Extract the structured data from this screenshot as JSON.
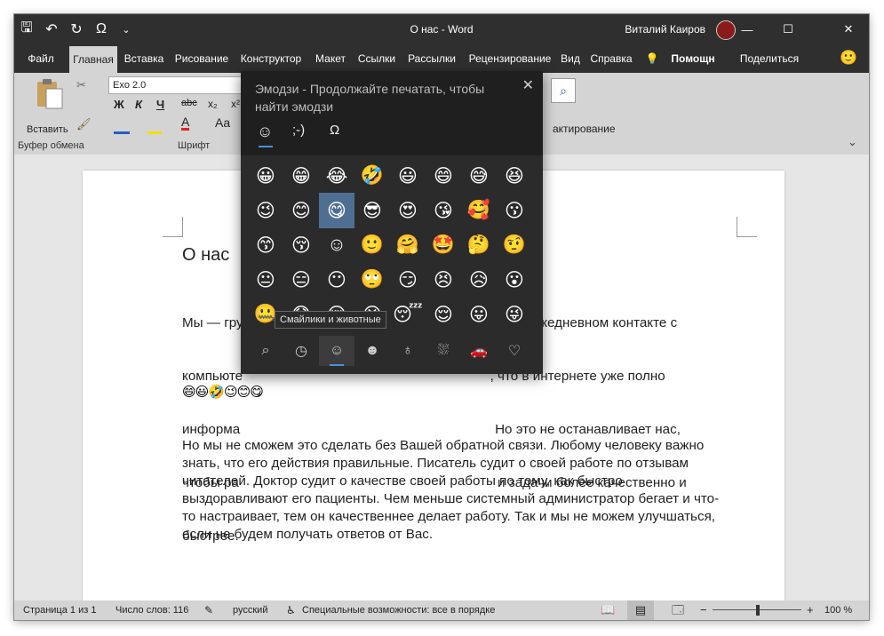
{
  "window": {
    "title": "О нас  -  Word",
    "user": "Виталий Каиров",
    "controls": {
      "minimize": "—",
      "maximize": "☐",
      "close": "✕"
    }
  },
  "qat": {
    "save": "🖫",
    "undo": "↶",
    "redo": "↻",
    "symbol": "Ω",
    "more": "⌄"
  },
  "tabs": [
    "Файл",
    "Главная",
    "Вставка",
    "Рисование",
    "Конструктор",
    "Макет",
    "Ссылки",
    "Рассылки",
    "Рецензирование",
    "Вид",
    "Справка"
  ],
  "tab_extra": {
    "help_hint": "Помощн",
    "share": "Поделиться"
  },
  "ribbon": {
    "paste_label": "Вставить",
    "clipboard_group": "Буфер обмена",
    "font_group": "Шрифт",
    "font_name": "Exo 2.0",
    "format_buttons": [
      "Ж",
      "К",
      "Ч",
      "abc",
      "x₂",
      "x²"
    ],
    "editing_label": "актирование"
  },
  "document": {
    "title": "О нас",
    "para1_lines": [
      "Мы — гру                                                                  Вам в ежедневном контакте с",
      "компьюте                                                                  , что в интернете уже полно",
      "информа                                                                    Но это не останавливает нас,",
      "чтобы ра                                                                     и задачи более качественно и",
      "быстрее."
    ],
    "emoji_line": "😄😃🤣😉😊😋",
    "para2_lines": [
      "Но мы не сможем это сделать без Вашей обратной связи. Любому человеку важно",
      "знать, что его действия правильные. Писатель судит о своей работе по отзывам",
      "читателей. Доктор судит о качестве своей работы по тому, как быстро",
      "выздоравливают его пациенты. Чем меньше системный администратор бегает и что-",
      "то настраивает, тем он качественнее делает работу. Так и мы не можем улучшаться,",
      "если не будем получать ответов от Вас."
    ]
  },
  "emoji_panel": {
    "title": "Эмодзи - Продолжайте печатать, чтобы найти эмодзи",
    "close": "✕",
    "mode_tabs": [
      "☺",
      ";-)",
      "Ω"
    ],
    "emojis": [
      "😀",
      "😁",
      "😂",
      "🤣",
      "😃",
      "😄",
      "😅",
      "😆",
      "😉",
      "😊",
      "😋",
      "😎",
      "😍",
      "😘",
      "🥰",
      "😗",
      "😙",
      "😚",
      "☺",
      "🙂",
      "🤗",
      "🤩",
      "🤔",
      "🤨",
      "😐",
      "😑",
      "😶",
      "🙄",
      "😏",
      "😣",
      "😥",
      "😮",
      "🤐",
      "😯",
      "😪",
      "😫",
      "😴",
      "😌",
      "😛",
      "😜"
    ],
    "tooltip": "Смайлики и животные",
    "category_icons": [
      "⌕",
      "◷",
      "☺",
      "☻",
      "♁",
      "⛆",
      "🚗",
      "♡"
    ]
  },
  "status": {
    "page": "Страница 1 из 1",
    "words": "Число слов: 116",
    "lang": "русский",
    "accessibility": "Специальные возможности: все в порядке",
    "zoom": "100 %",
    "zoom_minus": "−",
    "zoom_plus": "+"
  }
}
